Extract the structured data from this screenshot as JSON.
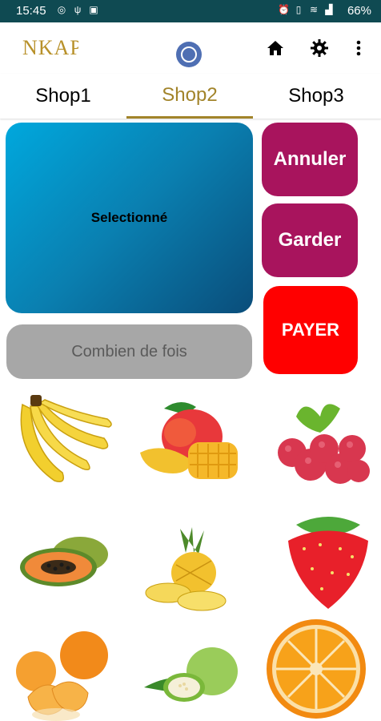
{
  "status_bar": {
    "time": "15:45",
    "battery": "66%",
    "icons_left": [
      "whatsapp-icon",
      "usb-icon",
      "download-icon"
    ],
    "icons_right": [
      "alarm-icon",
      "vibrate-icon",
      "wifi-icon",
      "signal-icon"
    ]
  },
  "app_bar": {
    "logo_text": "NKAP",
    "icons": [
      "whatsapp-icon",
      "home-icon",
      "gear-icon",
      "more-vert-icon"
    ]
  },
  "tabs": [
    {
      "label": "Shop1",
      "selected": false
    },
    {
      "label": "Shop2",
      "selected": true
    },
    {
      "label": "Shop3",
      "selected": false
    }
  ],
  "main": {
    "selected_label": "Selectionné",
    "times_placeholder": "Combien de fois",
    "buttons": {
      "cancel": "Annuler",
      "keep": "Garder",
      "pay": "PAYER"
    }
  },
  "fruits": [
    "banana",
    "mango",
    "raspberry",
    "papaya",
    "pineapple",
    "strawberry",
    "tangerine",
    "guava",
    "orange"
  ],
  "colors": {
    "status_bar": "#0f4a52",
    "accent": "#a2842a",
    "selected_panel": "#0a7fb0",
    "magenta_button": "#a8145d",
    "pay_button": "#ff0000",
    "input_bg": "#a7a7a7"
  }
}
